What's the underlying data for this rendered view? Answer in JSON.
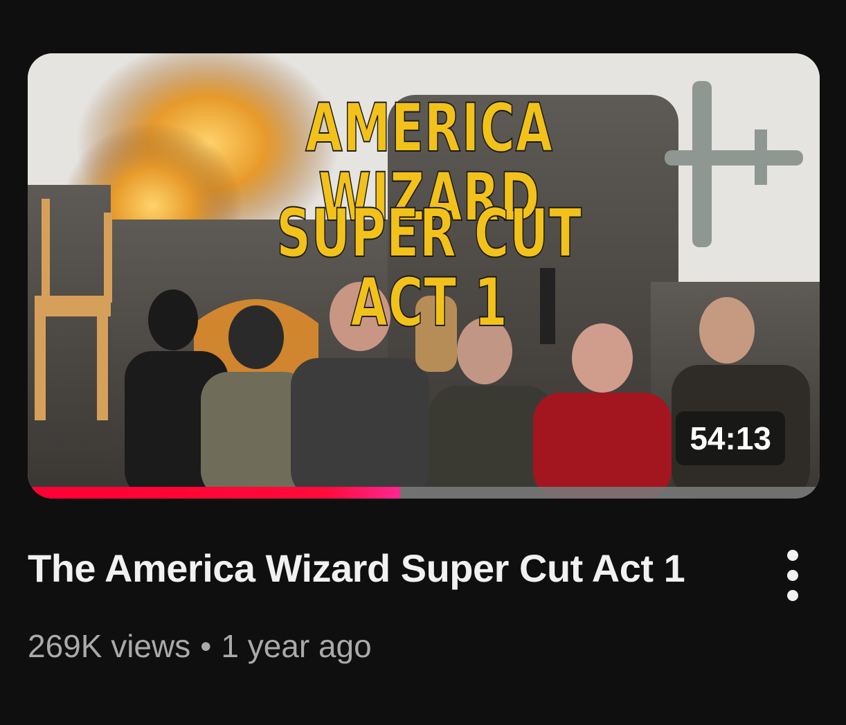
{
  "video": {
    "thumbnail_text_line1": "AMERICA WIZARD",
    "thumbnail_text_line2": "SUPER CUT ACT 1",
    "duration": "54:13",
    "watch_progress": 0.47,
    "title": "The America Wizard Super Cut Act 1",
    "views": "269K views",
    "separator": "•",
    "age": "1 year ago"
  },
  "icons": {
    "more": "more-vert-icon"
  },
  "colors": {
    "background": "#0f0f0f",
    "title_text": "#f1f1f1",
    "meta_text": "#aaaaaa",
    "progress": "#ff0033",
    "thumbnail_title": "#f2c21a"
  }
}
